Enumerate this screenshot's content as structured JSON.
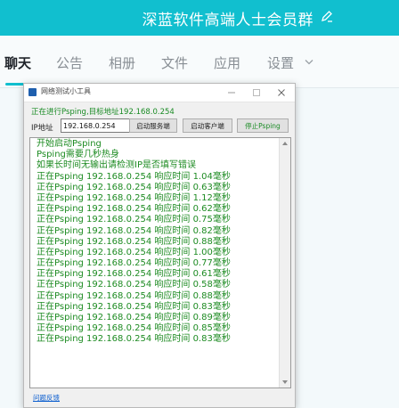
{
  "chat": {
    "group_name": "深蓝软件高端人士会员群",
    "tabs": [
      "聊天",
      "公告",
      "相册",
      "文件",
      "应用",
      "设置"
    ]
  },
  "window": {
    "title": "网络测试小工具",
    "status": "正在进行Psping,目标地址192.168.0.254",
    "ip_label": "IP地址",
    "ip_value": "192.168.0.254",
    "buttons": {
      "start_server": "启动服务端",
      "start_client": "启动客户端",
      "stop_psping": "停止Psping"
    },
    "log": [
      "开始启动Psping",
      "Psping需要几秒热身",
      "如果长时间无输出请检测IP是否填写错误",
      "正在Psping 192.168.0.254 响应时间 1.04毫秒",
      "正在Psping 192.168.0.254 响应时间 0.63毫秒",
      "正在Psping 192.168.0.254 响应时间 1.12毫秒",
      "正在Psping 192.168.0.254 响应时间 0.62毫秒",
      "正在Psping 192.168.0.254 响应时间 0.75毫秒",
      "正在Psping 192.168.0.254 响应时间 0.82毫秒",
      "正在Psping 192.168.0.254 响应时间 0.88毫秒",
      "正在Psping 192.168.0.254 响应时间 1.00毫秒",
      "正在Psping 192.168.0.254 响应时间 0.77毫秒",
      "正在Psping 192.168.0.254 响应时间 0.61毫秒",
      "正在Psping 192.168.0.254 响应时间 0.58毫秒",
      "正在Psping 192.168.0.254 响应时间 0.88毫秒",
      "正在Psping 192.168.0.254 响应时间 0.83毫秒",
      "正在Psping 192.168.0.254 响应时间 0.89毫秒",
      "正在Psping 192.168.0.254 响应时间 0.85毫秒",
      "正在Psping 192.168.0.254 响应时间 0.83毫秒"
    ],
    "feedback_link": "问题反馈"
  },
  "colors": {
    "accent": "#11bfcf",
    "log_text": "#1d8b22",
    "link": "#0b5ecf"
  }
}
